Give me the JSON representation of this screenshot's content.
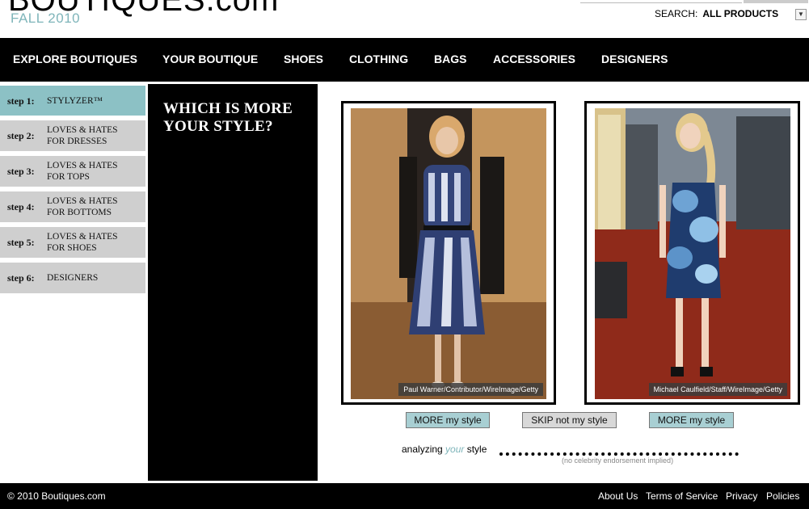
{
  "header": {
    "logo_main": "BOUTIQUES",
    "logo_tld": ".com",
    "season": "FALL 2010",
    "search_label": "SEARCH:",
    "search_scope": "ALL PRODUCTS"
  },
  "nav": [
    "EXPLORE BOUTIQUES",
    "YOUR BOUTIQUE",
    "SHOES",
    "CLOTHING",
    "BAGS",
    "ACCESSORIES",
    "DESIGNERS"
  ],
  "steps": [
    {
      "num": "step 1:",
      "label1": "STYLYZER™",
      "label2": ""
    },
    {
      "num": "step 2:",
      "label1": "LOVES & HATES",
      "label2": "FOR DRESSES"
    },
    {
      "num": "step 3:",
      "label1": "LOVES & HATES",
      "label2": "FOR TOPS"
    },
    {
      "num": "step 4:",
      "label1": "LOVES & HATES",
      "label2": "FOR BOTTOMS"
    },
    {
      "num": "step 5:",
      "label1": "LOVES & HATES",
      "label2": "FOR SHOES"
    },
    {
      "num": "step 6:",
      "label1": "DESIGNERS",
      "label2": ""
    }
  ],
  "question": "WHICH IS MORE YOUR STYLE?",
  "photos": {
    "left_credit": "Paul Warner/Contributor/WireImage/Getty",
    "right_credit": "Michael Caulfield/Staff/WireImage/Getty"
  },
  "buttons": {
    "more_left": "MORE my style",
    "skip": "SKIP not my style",
    "more_right": "MORE my style"
  },
  "analyzing": {
    "pre": "analyzing ",
    "em": "your",
    "post": " style",
    "disclaimer": "(no celebrity endorsement implied)"
  },
  "footer": {
    "copyright": "© 2010 Boutiques.com",
    "links": [
      "About Us",
      "Terms of Service",
      "Privacy",
      "Policies"
    ]
  },
  "colors": {
    "accent": "#7fb5ba",
    "active_step": "#8cc1c5",
    "inactive_step": "#cfcfcf"
  }
}
